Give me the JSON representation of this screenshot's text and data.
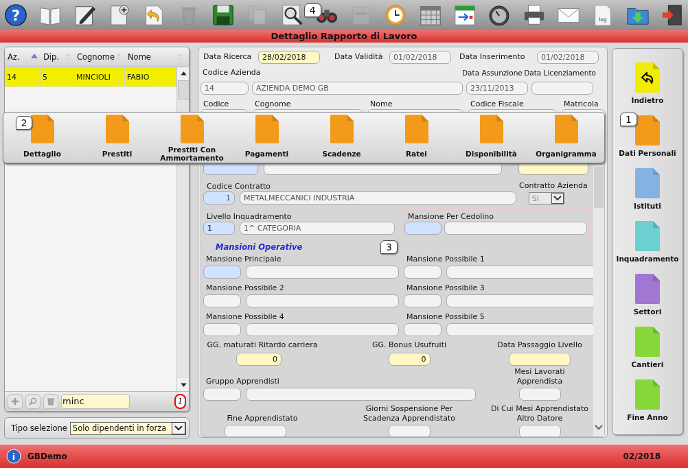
{
  "toolbar": {
    "help_mark": "?",
    "log_label": "log",
    "badge": "4"
  },
  "title": "Dettaglio Rapporto di Lavoro",
  "employee_list": {
    "columns": [
      {
        "label": "Az.",
        "sorted": true
      },
      {
        "label": "Dip.",
        "sorted": false
      },
      {
        "label": "Cognome",
        "sorted": false
      },
      {
        "label": "Nome",
        "sorted": false
      }
    ],
    "rows": [
      {
        "cells": [
          "14",
          "5",
          "MINCIOLI",
          "FABIO"
        ],
        "selected": true
      }
    ],
    "search": {
      "value": "minc"
    },
    "count": "1"
  },
  "selection": {
    "label": "Tipo selezione",
    "value": "Solo dipendenti in forza"
  },
  "popup": {
    "badge": "2",
    "items": [
      {
        "label": "Dettaglio"
      },
      {
        "label": "Prestiti"
      },
      {
        "label": "Prestiti Con Ammortamento"
      },
      {
        "label": "Pagamenti"
      },
      {
        "label": "Scadenze"
      },
      {
        "label": "Ratei"
      },
      {
        "label": "Disponibilità"
      },
      {
        "label": "Organigramma"
      }
    ]
  },
  "form": {
    "dates": [
      {
        "label": "Data Ricerca",
        "value": "28/02/2018",
        "color": "#fff8c4"
      },
      {
        "label": "Data Validità",
        "value": "01/02/2018",
        "color": "#f3f3f3"
      },
      {
        "label": "Data Inserimento",
        "value": "01/02/2018",
        "color": "#f3f3f3"
      }
    ],
    "company": {
      "label": "Codice Azienda",
      "code": "14",
      "name": "AZIENDA DEMO GB"
    },
    "hire": {
      "label": "Data Assunzione",
      "value": "23/11/2013"
    },
    "termination": {
      "label": "Data Licenziamento"
    },
    "identity_labels": [
      "Codice",
      "Cognome",
      "Nome",
      "Codice Fiscale",
      "Matricola"
    ],
    "contract": {
      "label": "Codice Contratto",
      "code": "1",
      "name": "METALMECCANICI INDUSTRIA"
    },
    "company_contract": {
      "label": "Contratto Azienda",
      "value": "SI"
    },
    "level": {
      "label": "Livello Inquadramento",
      "code": "1",
      "name": "1^ CATEGORIA"
    },
    "payslip_task": {
      "label": "Mansione Per Cedolino"
    },
    "section": {
      "title": "Mansioni Operative",
      "badge": "3"
    },
    "tasks": [
      {
        "label": "Mansione Principale",
        "color": "#cfe2ff"
      },
      {
        "label": "Mansione Possibile 1",
        "color": "#f3f3f3"
      },
      {
        "label": "Mansione Possibile 2",
        "color": "#f3f3f3"
      },
      {
        "label": "Mansione Possibile 3",
        "color": "#f3f3f3"
      },
      {
        "label": "Mansione Possibile 4",
        "color": "#f3f3f3"
      },
      {
        "label": "Mansione Possibile 5",
        "color": "#f3f3f3"
      }
    ],
    "bonus": [
      {
        "label": "GG. maturati Ritardo carriera",
        "value": "0"
      },
      {
        "label": "GG. Bonus Usufruiti",
        "value": "0"
      },
      {
        "label": "Data Passaggio Livello"
      }
    ],
    "apprentice_group": {
      "label": "Gruppo Apprendisti"
    },
    "months_worked": {
      "label": "Mesi Lavorati Apprendista"
    },
    "bottom": [
      {
        "label": "Fine Apprendistato"
      },
      {
        "label": "Giorni Sospensione Per Scadenza Apprendistato"
      },
      {
        "label": "Di Cui Mesi Apprendistato Altro Datore"
      }
    ]
  },
  "sidebar": {
    "items": [
      {
        "label": "Indietro",
        "color": "#f2ec00",
        "kind": "back"
      },
      {
        "label": "Dati Personali",
        "color": "#f39a1a",
        "kind": "page",
        "badge": "1"
      },
      {
        "label": "Istituti",
        "color": "#86b2e2",
        "kind": "page"
      },
      {
        "label": "Inquadramento",
        "color": "#6ccfd2",
        "kind": "page"
      },
      {
        "label": "Settori",
        "color": "#a077d2",
        "kind": "page"
      },
      {
        "label": "Cantieri",
        "color": "#86d838",
        "kind": "page"
      },
      {
        "label": "Fine Anno",
        "color": "#86d838",
        "kind": "page"
      }
    ]
  },
  "status_bar": {
    "info_mark": "i",
    "app": "GBDemo",
    "period": "02/2018"
  }
}
